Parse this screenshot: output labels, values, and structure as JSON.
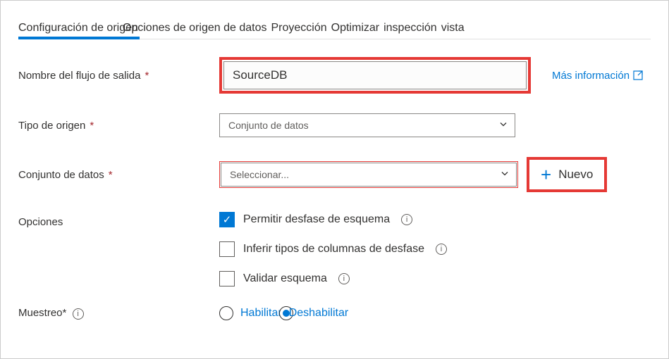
{
  "tabs": {
    "configuracion": "Configuración de origen",
    "opciones": "Opciones de origen de datos",
    "proyeccion": "Proyección",
    "optimizar": "Optimizar",
    "inspeccion": "inspección",
    "vista": "vista"
  },
  "labels": {
    "output_stream_name": "Nombre del flujo de salida",
    "source_type": "Tipo de origen",
    "dataset": "Conjunto de datos",
    "options": "Opciones",
    "sampling": "Muestreo*"
  },
  "fields": {
    "output_stream_name_value": "SourceDB",
    "source_type_value": "Conjunto de datos",
    "dataset_value": "Seleccionar..."
  },
  "links": {
    "more_info": "Más información",
    "new": "Nuevo"
  },
  "options": {
    "allow_schema_drift": "Permitir desfase de esquema",
    "infer_drift_types": "Inferir tipos de columnas de desfase",
    "validate_schema": "Validar esquema"
  },
  "sampling": {
    "enable": "Habilitar",
    "disable": "Deshabilitar"
  }
}
